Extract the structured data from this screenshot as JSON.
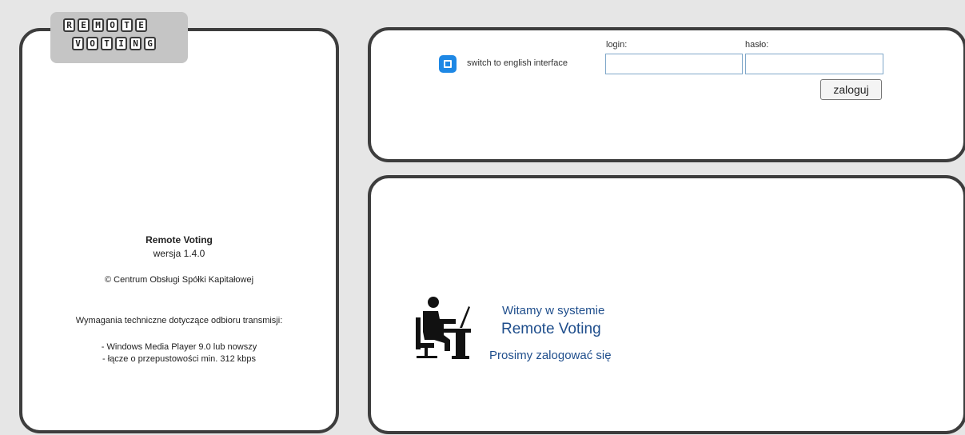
{
  "logo": {
    "row1": [
      "R",
      "E",
      "M",
      "O",
      "T",
      "E"
    ],
    "row2": [
      "V",
      "O",
      "T",
      "I",
      "N",
      "G"
    ]
  },
  "info": {
    "app_name": "Remote Voting",
    "version": "wersja 1.4.0",
    "copyright": "© Centrum Obsługi Spółki Kapitałowej",
    "requirements_title": "Wymagania techniczne dotyczące odbioru transmisji:",
    "requirements": [
      "- Windows Media Player 9.0 lub nowszy",
      "- łącze o przepustowości min. 312 kbps"
    ]
  },
  "login_form": {
    "language_icon": "window-icon",
    "language_link": "switch to english interface",
    "login_label": "login:",
    "login_value": "",
    "password_label": "hasło:",
    "password_value": "",
    "submit_label": "zaloguj",
    "accent_color": "#1e88e5"
  },
  "welcome": {
    "icon": "person-at-desk-icon",
    "line1": "Witamy w systemie",
    "line2": "Remote Voting",
    "line3": "Prosimy zalogować się",
    "color": "#1f4e8c"
  }
}
